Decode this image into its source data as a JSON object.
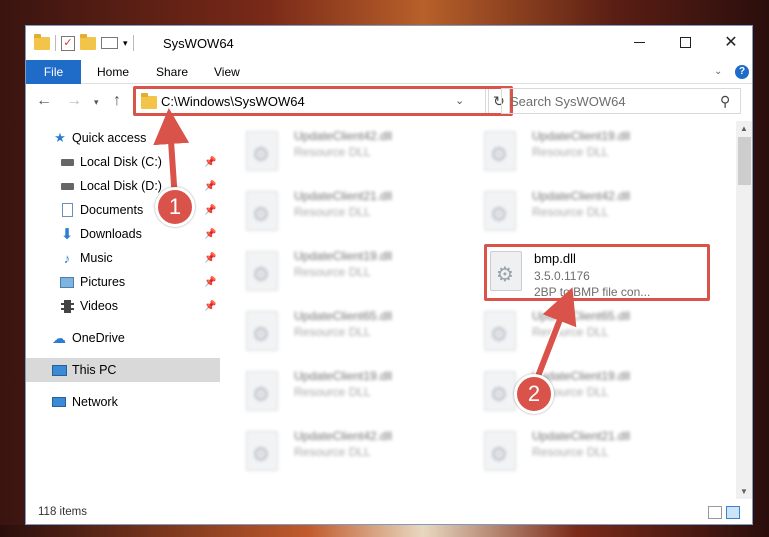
{
  "window": {
    "title": "SysWOW64"
  },
  "ribbon": {
    "tabs": [
      "File",
      "Home",
      "Share",
      "View"
    ]
  },
  "address": {
    "path": "C:\\Windows\\SysWOW64",
    "search_placeholder": "Search SysWOW64"
  },
  "nav": {
    "items": [
      {
        "label": "Quick access",
        "icon": "star-icon"
      },
      {
        "label": "Local Disk (C:)",
        "icon": "disk-icon"
      },
      {
        "label": "Local Disk (D:)",
        "icon": "disk-icon"
      },
      {
        "label": "Documents",
        "icon": "documents-icon"
      },
      {
        "label": "Downloads",
        "icon": "download-icon"
      },
      {
        "label": "Music",
        "icon": "music-icon"
      },
      {
        "label": "Pictures",
        "icon": "pictures-icon"
      },
      {
        "label": "Videos",
        "icon": "videos-icon"
      },
      {
        "label": "OneDrive",
        "icon": "cloud-icon"
      },
      {
        "label": "This PC",
        "icon": "computer-icon"
      },
      {
        "label": "Network",
        "icon": "network-icon"
      }
    ]
  },
  "files": [
    {
      "name": "UpdateClient42.dll",
      "desc": "Resource DLL"
    },
    {
      "name": "UpdateClient19.dll",
      "desc": "Resource DLL"
    },
    {
      "name": "UpdateClient21.dll",
      "desc": "Resource DLL"
    },
    {
      "name": "UpdateClient42.dll",
      "desc": "Resource DLL"
    },
    {
      "name": "UpdateClient19.dll",
      "desc": "Resource DLL"
    },
    {
      "name": "UpdateClient65.dll",
      "desc": "Resource DLL"
    },
    {
      "name": "UpdateClient65.dll",
      "desc": "Resource DLL"
    },
    {
      "name": "UpdateClient19.dll",
      "desc": "Resource DLL"
    },
    {
      "name": "UpdateClient19.dll",
      "desc": "Resource DLL"
    },
    {
      "name": "UpdateClient42.dll",
      "desc": "Resource DLL"
    },
    {
      "name": "UpdateClient21.dll",
      "desc": "Resource DLL"
    }
  ],
  "highlighted_file": {
    "name": "bmp.dll",
    "version": "3.5.0.1176",
    "desc": "2BP to BMP file con..."
  },
  "status": {
    "item_count": "118 items"
  },
  "annotations": {
    "step1": "1",
    "step2": "2",
    "color": "#d9534a"
  }
}
